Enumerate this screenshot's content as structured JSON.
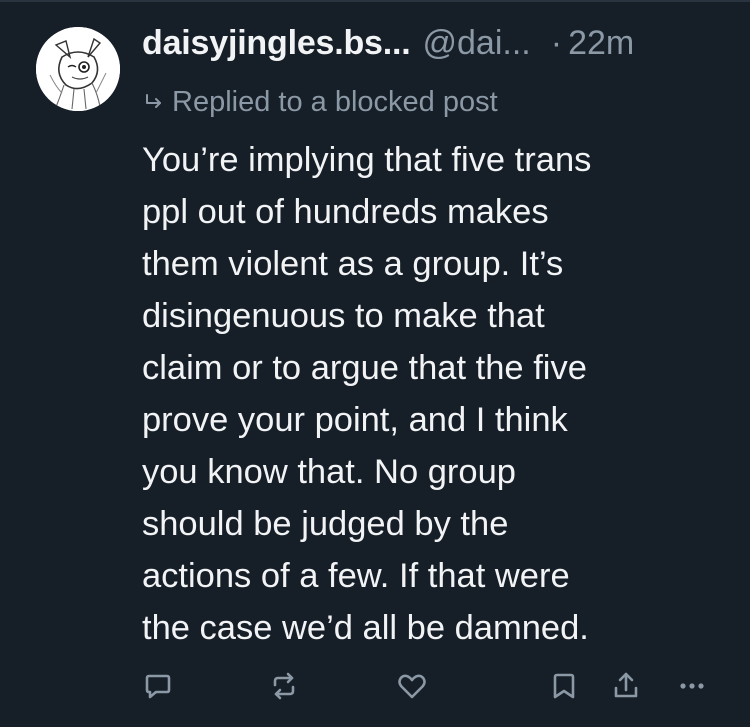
{
  "post": {
    "display_name": "daisyjingles.bs...",
    "handle": "@dai...",
    "separator": "·",
    "timestamp": "22m",
    "reply_context": "Replied to a blocked post",
    "body_lines": [
      "You’re implying that five trans",
      "ppl out of hundreds makes",
      "them violent as a group. It’s",
      "disingenuous to make that",
      "claim or to argue that the five",
      "prove your point, and I think",
      "you know that. No group",
      "should be judged by the",
      "actions of a few. If that were",
      "the case we’d all be damned."
    ]
  },
  "actions": {
    "icons": [
      "reply-icon",
      "repost-icon",
      "like-icon",
      "bookmark-icon",
      "share-icon",
      "more-icon"
    ]
  },
  "colors": {
    "background": "#161e27",
    "text": "#f1f3f5",
    "muted": "#8b98a5",
    "icon": "#8b98a5"
  }
}
